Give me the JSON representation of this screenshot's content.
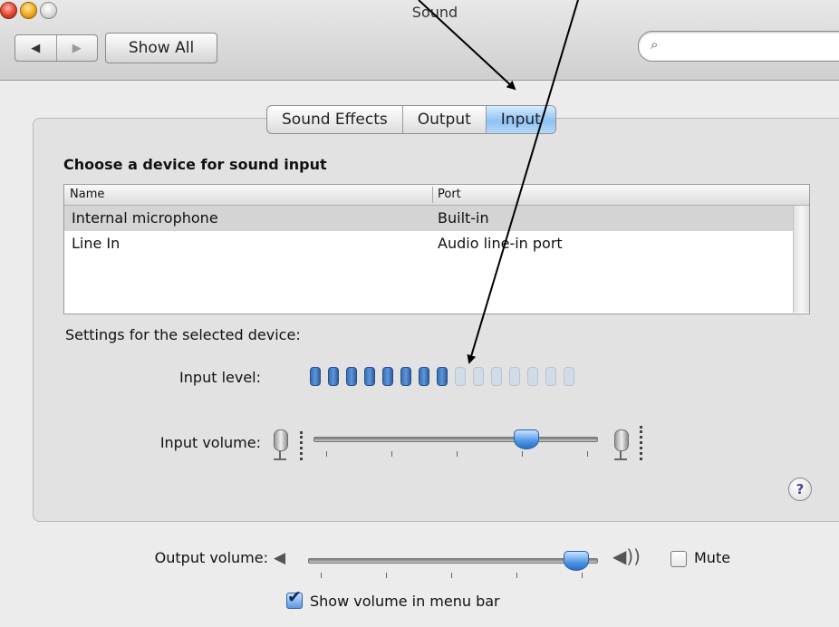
{
  "window": {
    "title": "Sound",
    "back_icon": "◀",
    "forward_icon": "▶",
    "show_all_label": "Show All",
    "search_icon": "⌕",
    "search_value": "",
    "search_placeholder": ""
  },
  "tabs": [
    {
      "label": "Sound Effects",
      "active": false
    },
    {
      "label": "Output",
      "active": false
    },
    {
      "label": "Input",
      "active": true
    }
  ],
  "input_panel": {
    "heading": "Choose a device for sound input",
    "table": {
      "columns": [
        "Name",
        "Port"
      ],
      "rows": [
        {
          "name": "Internal microphone",
          "port": "Built-in",
          "selected": true
        },
        {
          "name": "Line In",
          "port": "Audio line-in port",
          "selected": false
        }
      ]
    },
    "settings_label": "Settings for the selected device:",
    "input_level_label": "Input level:",
    "input_level": {
      "lit": 8,
      "total": 15
    },
    "input_volume_label": "Input volume:",
    "input_volume_fraction": 0.8
  },
  "help_label": "?",
  "output": {
    "volume_label": "Output volume:",
    "volume_fraction": 1.0,
    "mute_label": "Mute",
    "mute_checked": false,
    "show_in_menu_bar_label": "Show volume in menu bar",
    "show_in_menu_bar_checked": true,
    "checkmark": "✔",
    "speaker_low_icon": "◀",
    "speaker_high_icon": "◀))"
  },
  "colors": {
    "accent_blue": "#4d94e6",
    "level_on": "#3a6fb7",
    "level_off": "#d2dbe8",
    "window_bg": "#ececec"
  }
}
